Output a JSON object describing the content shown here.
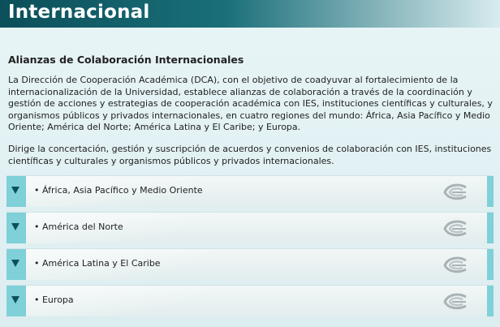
{
  "header": {
    "title": "Internacional"
  },
  "section": {
    "subtitle": "Alianzas de Colaboración Internacionales",
    "paragraph1_lines": [
      "La Dirección de Cooperación Académica (DCA), con el objetivo de coadyuvar al fortalecimiento de la",
      "internacionalización de la Universidad, establece alianzas de colaboración a través de la coordinación y",
      "gestión de acciones y estrategias de cooperación académica con IES, instituciones científicas y culturales, y",
      "organismos públicos y privados internacionales, en cuatro regiones del mundo: África, Asia Pacífico y Medio",
      "Oriente; América del Norte; América Latina y El Caribe; y Europa."
    ],
    "paragraph2_lines": [
      "Dirige la concertación, gestión y suscripción de acuerdos y convenios de colaboración con IES, instituciones",
      "científicas y culturales y organismos públicos y privados internacionales."
    ]
  },
  "accordion": [
    {
      "label": "• África, Asia Pacífico y Medio Oriente"
    },
    {
      "label": "• América del Norte"
    },
    {
      "label": "• América Latina y El Caribe"
    },
    {
      "label": "• Europa"
    }
  ],
  "colors": {
    "header_dark": "#0b4f5a",
    "tab_accent": "#7fd0d8",
    "arrow": "#0d4f59"
  },
  "icons": {
    "expand": "triangle-down-icon",
    "emblem": "university-emblem-icon"
  }
}
